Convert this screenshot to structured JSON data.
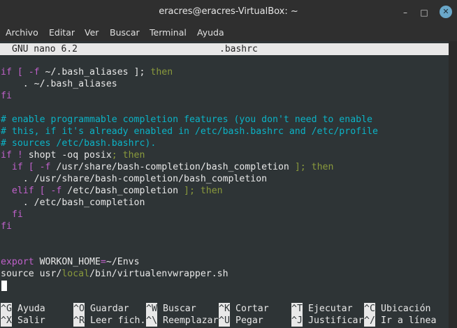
{
  "window": {
    "title": "eracres@eracres-VirtualBox: ~"
  },
  "menu": [
    "Archivo",
    "Editar",
    "Ver",
    "Buscar",
    "Terminal",
    "Ayuda"
  ],
  "nano": {
    "version": "GNU nano 6.2",
    "filename": ".bashrc"
  },
  "code": {
    "l1": {
      "a": "if [ ",
      "b": "-f",
      "c": " ~/.bash_aliases ]; ",
      "d": "then"
    },
    "l2": "    . ~/.bash_aliases",
    "l3": "fi",
    "l5": "# enable programmable completion features (you don't need to enable",
    "l6": "# this, if it's already enabled in /etc/bash.bashrc and /etc/profile",
    "l7": "# sources /etc/bash.bashrc).",
    "l8": {
      "a": "if ! ",
      "b": "shopt -oq posix",
      "c": "; then"
    },
    "l9": {
      "a": "  if [ ",
      "b": "-f",
      "c": " /usr/share/bash-completion/bash_completion ",
      "d": "]; then"
    },
    "l10": "    . /usr/share/bash-completion/bash_completion",
    "l11": {
      "a": "  elif [ ",
      "b": "-f",
      "c": " /etc/bash_completion ",
      "d": "]; then"
    },
    "l12": "    . /etc/bash_completion",
    "l13": "  fi",
    "l14": "fi",
    "l17": {
      "a": "export ",
      "b": "WORKON_HOME",
      "c": "=",
      "d": "~/Envs"
    },
    "l18": {
      "a": "source usr/",
      "b": "local",
      "c": "/bin/virtualenvwrapper.sh"
    }
  },
  "shortcuts": [
    {
      "key": "^G",
      "label": "Ayuda"
    },
    {
      "key": "^O",
      "label": "Guardar"
    },
    {
      "key": "^W",
      "label": "Buscar"
    },
    {
      "key": "^K",
      "label": "Cortar"
    },
    {
      "key": "^T",
      "label": "Ejecutar"
    },
    {
      "key": "^C",
      "label": "Ubicación"
    },
    {
      "key": "^X",
      "label": "Salir"
    },
    {
      "key": "^R",
      "label": "Leer fich."
    },
    {
      "key": "^\\",
      "label": "Reemplazar"
    },
    {
      "key": "^U",
      "label": "Pegar"
    },
    {
      "key": "^J",
      "label": "Justificar"
    },
    {
      "key": "^/",
      "label": "Ir a línea"
    }
  ]
}
